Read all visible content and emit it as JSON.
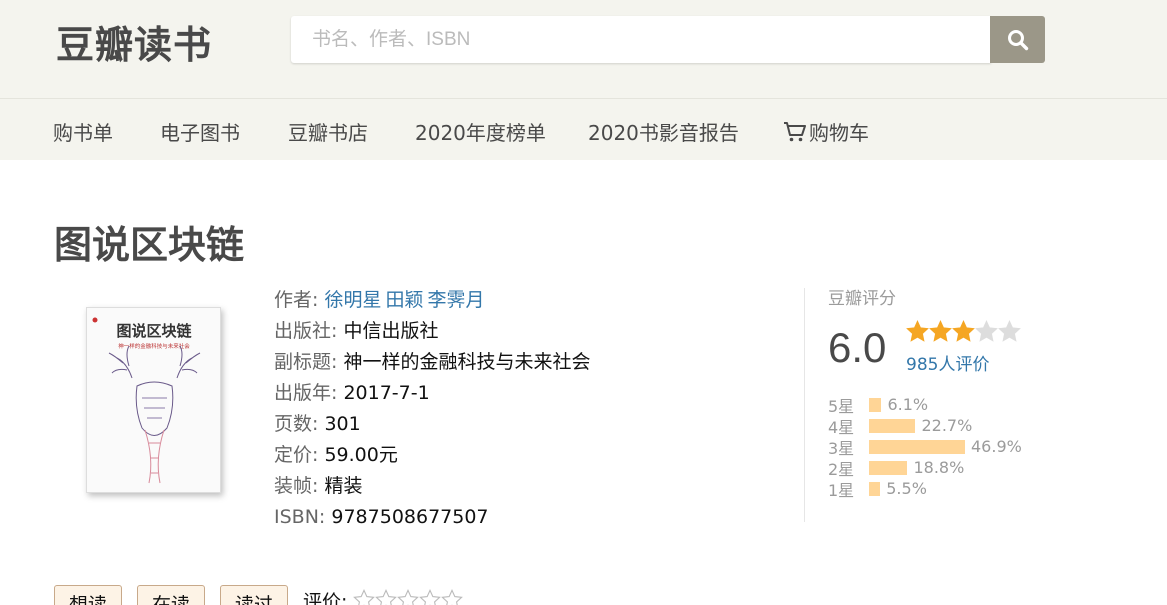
{
  "header": {
    "logo": "豆瓣读书",
    "search_placeholder": "书名、作者、ISBN"
  },
  "nav": {
    "items": [
      "购书单",
      "电子图书",
      "豆瓣书店",
      "2020年度榜单",
      "2020书影音报告",
      "购物车"
    ]
  },
  "book": {
    "title": "图说区块链",
    "cover": {
      "title": "图说区块链",
      "subtitle": "神一样的金融科技与未来社会"
    },
    "author_label": "作者:",
    "authors": [
      "徐明星",
      "田颖",
      "李霁月"
    ],
    "publisher_label": "出版社:",
    "publisher": "中信出版社",
    "subtitle_label": "副标题:",
    "subtitle": "神一样的金融科技与未来社会",
    "year_label": "出版年:",
    "year": "2017-7-1",
    "pages_label": "页数:",
    "pages": "301",
    "price_label": "定价:",
    "price": "59.00元",
    "binding_label": "装帧:",
    "binding": "精装",
    "isbn_label": "ISBN:",
    "isbn": "9787508677507"
  },
  "rating": {
    "title": "豆瓣评分",
    "score": "6.0",
    "stars_filled": 3,
    "votes": "985人评价",
    "distribution": [
      {
        "label": "5星",
        "percent": "6.1%",
        "value": 6.1
      },
      {
        "label": "4星",
        "percent": "22.7%",
        "value": 22.7
      },
      {
        "label": "3星",
        "percent": "46.9%",
        "value": 46.9
      },
      {
        "label": "2星",
        "percent": "18.8%",
        "value": 18.8
      },
      {
        "label": "1星",
        "percent": "5.5%",
        "value": 5.5
      }
    ]
  },
  "actions": {
    "want": "想读",
    "reading": "在读",
    "read": "读过",
    "rate_label": "评价:"
  },
  "colors": {
    "link": "#3377aa",
    "bar": "#ffd596",
    "star": "#f5a623",
    "star_empty": "#dddddd"
  }
}
